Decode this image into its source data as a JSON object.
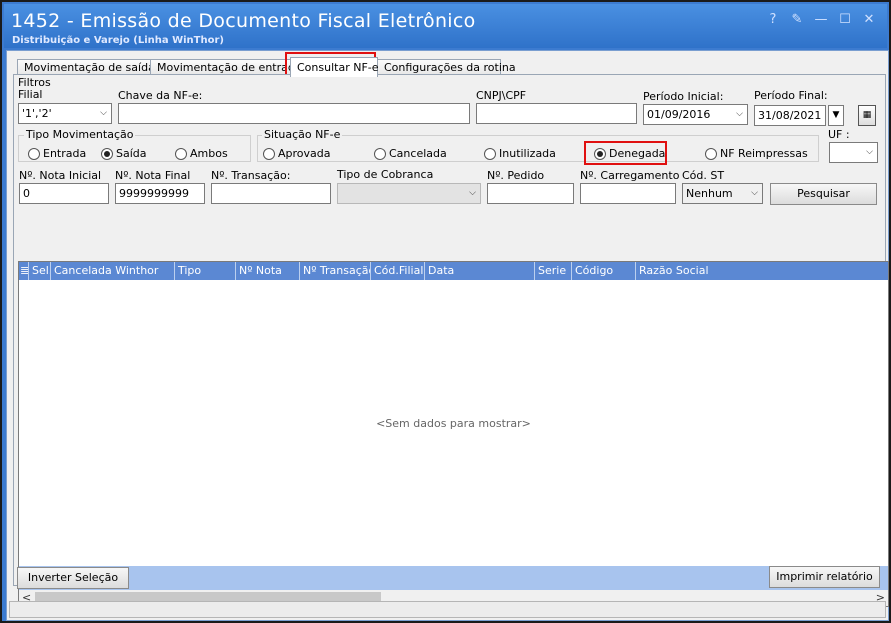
{
  "window": {
    "title": "1452 - Emissão de Documento Fiscal Eletrônico",
    "subtitle": "Distribuição e Varejo (Linha WinThor)",
    "btn_help": "?",
    "btn_edit": "✎",
    "btn_min": "—",
    "btn_max": "☐",
    "btn_close": "✕"
  },
  "tabs": [
    {
      "label": "Movimentação de saída"
    },
    {
      "label": "Movimentação de entrada"
    },
    {
      "label": "Consultar NF-e"
    },
    {
      "label": "Configurações da rotina"
    }
  ],
  "filters": {
    "group_label": "Filtros",
    "filial_label": "Filial",
    "filial_value": "'1','2'",
    "chave_label": "Chave da NF-e:",
    "chave_value": "",
    "cnpj_label": "CNPJ\\CPF",
    "cnpj_value": "",
    "periodo_inicial_label": "Período Inicial:",
    "periodo_inicial_value": "01/09/2016",
    "periodo_final_label": "Período Final:",
    "periodo_final_value": "31/08/2021",
    "tipo_mov_label": "Tipo Movimentação",
    "tipo_mov_options": [
      "Entrada",
      "Saída",
      "Ambos"
    ],
    "tipo_mov_selected": "Saída",
    "situacao_label": "Situação NF-e",
    "situacao_options": [
      "Aprovada",
      "Cancelada",
      "Inutilizada",
      "Denegada",
      "NF Reimpressas"
    ],
    "situacao_selected": "Denegada",
    "uf_label": "UF :",
    "uf_value": "",
    "nota_inicial_label": "Nº. Nota Inicial",
    "nota_inicial_value": "0",
    "nota_final_label": "Nº. Nota Final",
    "nota_final_value": "9999999999",
    "transacao_label": "Nº. Transação:",
    "transacao_value": "",
    "tipo_cobranca_label": "Tipo de Cobranca",
    "tipo_cobranca_value": "",
    "pedido_label": "Nº. Pedido",
    "pedido_value": "",
    "carregamento_label": "Nº. Carregamento",
    "carregamento_value": "",
    "cod_st_label": "Cód. ST",
    "cod_st_value": "Nenhum",
    "pesquisar_label": "Pesquisar"
  },
  "grid": {
    "columns": [
      "Sel.",
      "Cancelada Winthor",
      "Tipo",
      "Nº Nota",
      "Nº Transação",
      "Cód.Filial",
      "Data",
      "Serie",
      "Código",
      "Razão Social"
    ],
    "empty_text": "<Sem dados para mostrar>"
  },
  "footer": {
    "inverter_label": "Inverter Seleção",
    "imprimir_label": "Imprimir relatório"
  }
}
